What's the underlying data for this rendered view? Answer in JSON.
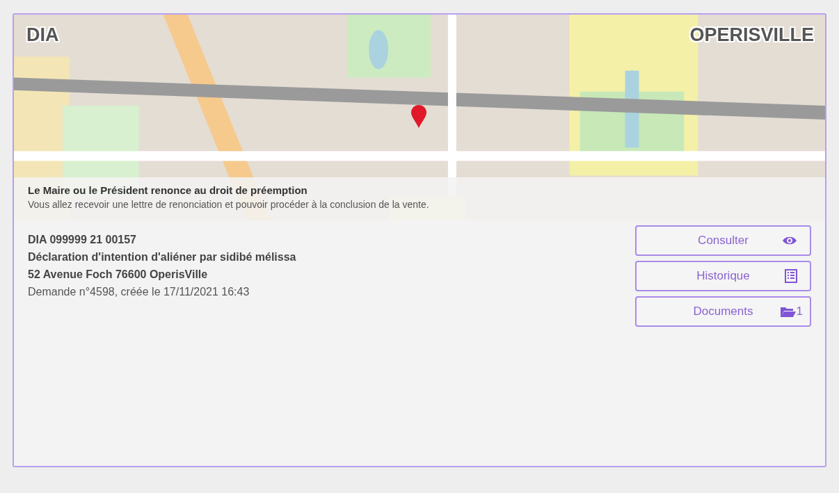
{
  "header": {
    "type_label": "DIA",
    "city": "OPERISVILLE"
  },
  "notice": {
    "title": "Le Maire ou le Président renonce au droit de préemption",
    "message": "Vous allez recevoir une lettre de renonciation et pouvoir procéder à la conclusion de la vente."
  },
  "details": {
    "reference": "DIA 099999 21 00157",
    "title": "Déclaration d'intention d'aliéner par sidibé mélissa",
    "address": "52 Avenue Foch 76600 OperisVille",
    "request": "Demande n°4598, créée le 17/11/2021 16:43"
  },
  "actions": [
    {
      "label": "Consulter",
      "kind": "view"
    },
    {
      "label": "Historique",
      "kind": "history"
    },
    {
      "label": "Documents",
      "kind": "documents",
      "count": "1"
    }
  ]
}
